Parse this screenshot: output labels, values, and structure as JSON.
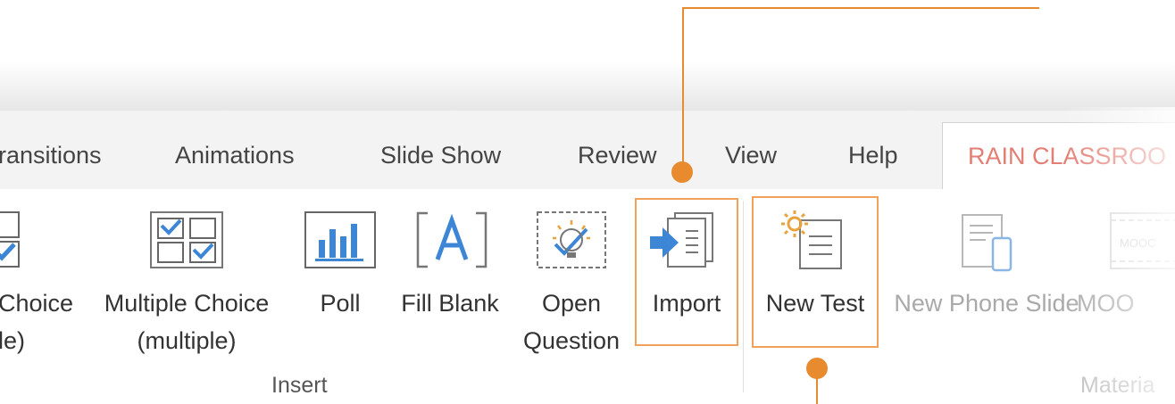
{
  "tabs": {
    "transitions": "ransitions",
    "animations": "Animations",
    "slide_show": "Slide Show",
    "review": "Review",
    "view": "View",
    "help": "Help",
    "rain_classroom": "RAIN CLASSROO"
  },
  "insert_group": {
    "single_choice_line1": "Choice",
    "single_choice_line2": "le)",
    "multiple_choice_line1": "Multiple Choice",
    "multiple_choice_line2": "(multiple)",
    "poll": "Poll",
    "fill_blank": "Fill Blank",
    "open_question_line1": "Open",
    "open_question_line2": "Question",
    "import": "Import",
    "label": "Insert"
  },
  "material_group": {
    "new_test": "New Test",
    "new_phone_slide": "New Phone Slide",
    "mooc": "MOO",
    "label": "Materia",
    "mooc_icon_text": "MOOC"
  },
  "icons": {
    "single_choice": "checkbox-list-icon",
    "multiple_choice": "multi-checkbox-icon",
    "poll": "bar-chart-icon",
    "fill_blank": "bracket-a-icon",
    "open_question": "lightbulb-check-icon",
    "import": "import-arrow-icon",
    "new_test": "sun-document-icon",
    "new_phone_slide": "phone-slide-icon",
    "mooc": "mooc-film-icon"
  },
  "colors": {
    "accent_orange": "#e88a2e",
    "highlight_border": "#f0a25d",
    "active_tab_text": "#e37e74",
    "icon_blue": "#3d86d6"
  }
}
